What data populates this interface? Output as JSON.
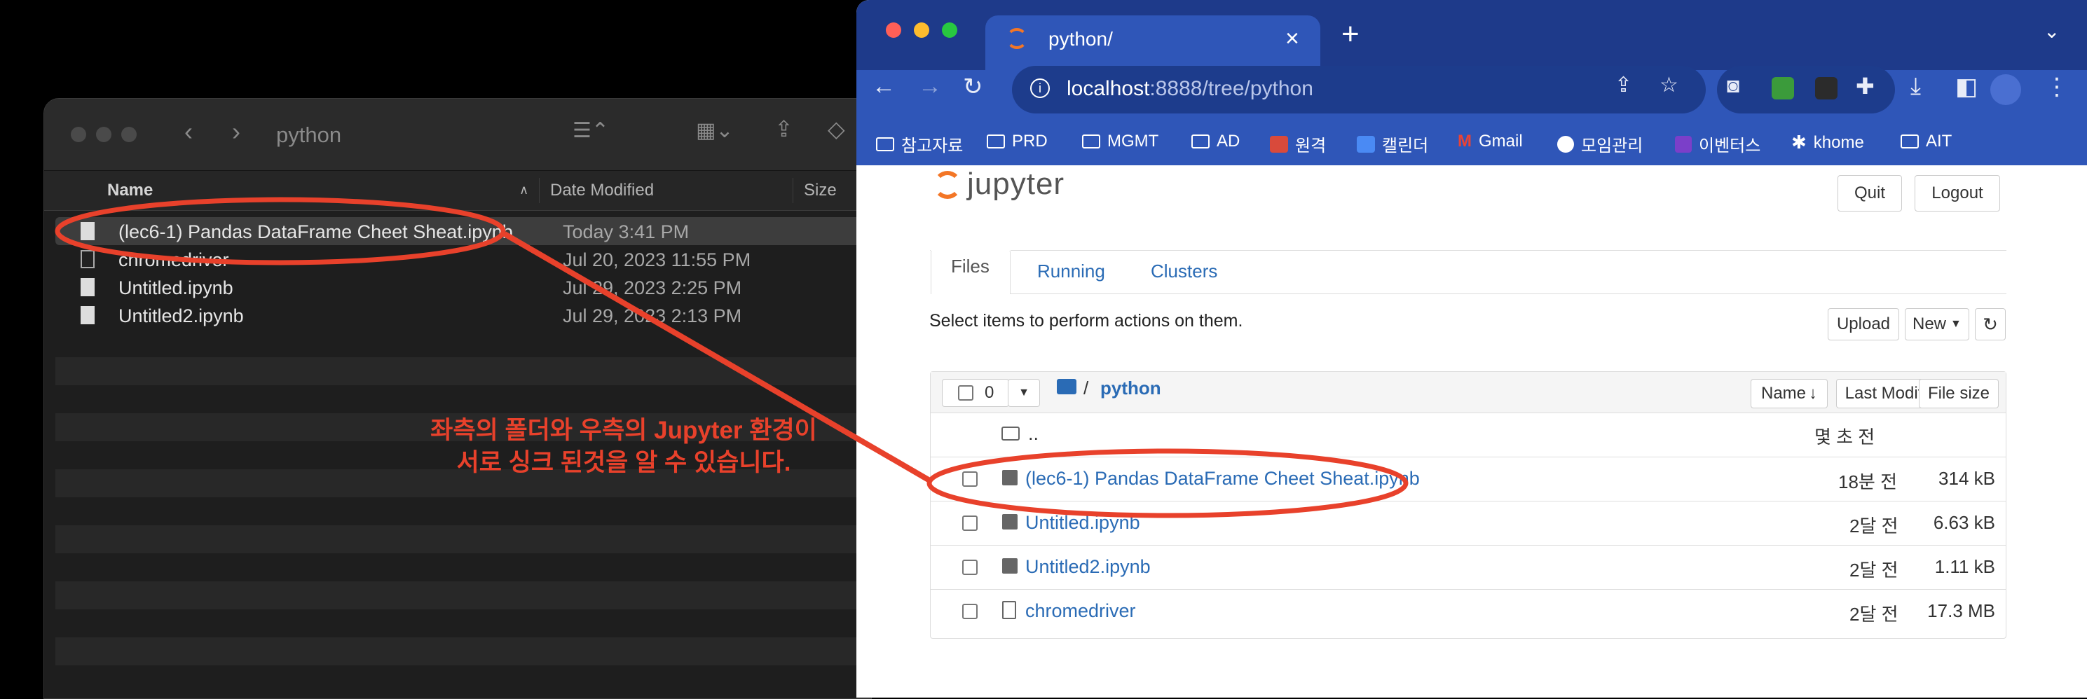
{
  "finder": {
    "title": "python",
    "columns": {
      "name": "Name",
      "date": "Date Modified",
      "size": "Size"
    },
    "files": [
      {
        "name": "(lec6-1) Pandas DataFrame Cheet Sheat.ipynb",
        "date": "Today 3:41 PM"
      },
      {
        "name": "chromedriver",
        "date": "Jul 20, 2023 11:55 PM"
      },
      {
        "name": "Untitled.ipynb",
        "date": "Jul 29, 2023 2:25 PM"
      },
      {
        "name": "Untitled2.ipynb",
        "date": "Jul 29, 2023 2:13 PM"
      }
    ]
  },
  "browser": {
    "tab_title": "python/",
    "url_host": "localhost",
    "url_rest": ":8888/tree/python",
    "bookmarks": [
      "참고자료",
      "PRD",
      "MGMT",
      "AD",
      "원격",
      "캘린더",
      "Gmail",
      "모임관리",
      "이벤터스",
      "khome",
      "AIT"
    ]
  },
  "jupyter": {
    "logo": "jupyter",
    "quit_label": "Quit",
    "logout_label": "Logout",
    "tabs": [
      "Files",
      "Running",
      "Clusters"
    ],
    "select_hint": "Select items to perform actions on them.",
    "upload_label": "Upload",
    "new_label": "New",
    "selected_count": "0",
    "breadcrumb_root": "/",
    "breadcrumb_folder": "python",
    "sort_name": "Name",
    "sort_modified": "Last Modified",
    "sort_size": "File size",
    "parent_dir": "..",
    "parent_modified": "몇 초 전",
    "items": [
      {
        "name": "(lec6-1) Pandas DataFrame Cheet Sheat.ipynb",
        "modified": "18분 전",
        "size": "314 kB",
        "kind": "notebook"
      },
      {
        "name": "Untitled.ipynb",
        "modified": "2달 전",
        "size": "6.63 kB",
        "kind": "notebook"
      },
      {
        "name": "Untitled2.ipynb",
        "modified": "2달 전",
        "size": "1.11 kB",
        "kind": "notebook"
      },
      {
        "name": "chromedriver",
        "modified": "2달 전",
        "size": "17.3 MB",
        "kind": "file"
      }
    ]
  },
  "annotation": {
    "line1": "좌측의 폴더와 우측의 Jupyter 환경이",
    "line2": "서로 싱크 된것을 알 수 있습니다.",
    "color": "#e8412b"
  }
}
